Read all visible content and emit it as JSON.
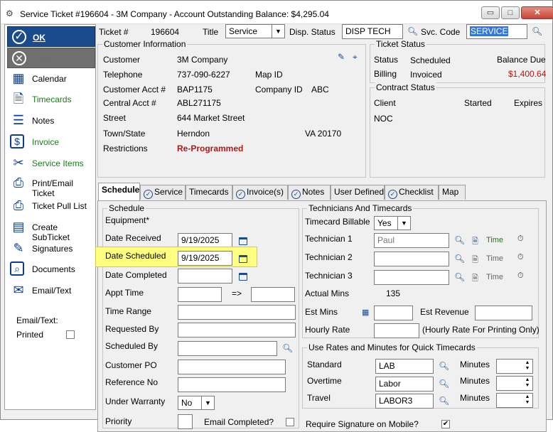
{
  "window": {
    "title": "Service Ticket #196604 - 3M Company - Account Outstanding Balance: $4,295.04",
    "minimize": "▭",
    "maximize": "□",
    "close": "✕"
  },
  "sidebar": {
    "ok": "OK",
    "cancel": "Cancel",
    "items": [
      {
        "label": "Calendar",
        "icon": "calendar-icon",
        "glyph": "▦"
      },
      {
        "label": "Timecards",
        "icon": "timecard-icon",
        "glyph": "🗎"
      },
      {
        "label": "Notes",
        "icon": "notes-icon",
        "glyph": "☰"
      },
      {
        "label": "Invoice",
        "icon": "invoice-icon",
        "glyph": "$"
      },
      {
        "label": "Service Items",
        "icon": "tools-icon",
        "glyph": "✂"
      },
      {
        "label": "Print/Email Ticket",
        "icon": "printer-icon",
        "glyph": "⎙"
      },
      {
        "label": "Ticket Pull List",
        "icon": "printer-icon",
        "glyph": "⎙"
      },
      {
        "label": "Create SubTicket",
        "icon": "subticket-icon",
        "glyph": "▤"
      },
      {
        "label": "Signatures",
        "icon": "signature-icon",
        "glyph": "✎"
      },
      {
        "label": "Documents",
        "icon": "documents-icon",
        "glyph": "⌕"
      },
      {
        "label": "Email/Text",
        "icon": "email-icon",
        "glyph": "✉"
      }
    ],
    "email_text_label": "Email/Text:",
    "printed_label": "Printed"
  },
  "header": {
    "ticket_label": "Ticket #",
    "ticket_value": "196604",
    "title_label": "Title",
    "title_value": "Service",
    "disp_status_label": "Disp. Status",
    "disp_status_value": "DISP TECH",
    "svc_code_label": "Svc. Code",
    "svc_code_value": "SERVICE"
  },
  "customer_info": {
    "legend": "Customer Information",
    "customer_label": "Customer",
    "customer_value": "3M Company",
    "telephone_label": "Telephone",
    "telephone_value": "737-090-6227",
    "map_id_label": "Map ID",
    "cust_acct_label": "Customer Acct #",
    "cust_acct_value": "BAP1175",
    "company_id_label": "Company ID",
    "company_id_value": "ABC",
    "central_acct_label": "Central Acct #",
    "central_acct_value": "ABL271175",
    "street_label": "Street",
    "street_value": "644 Market Street",
    "town_label": "Town/State",
    "town_value": "Herndon",
    "state_zip": "VA  20170",
    "restrictions_label": "Restrictions",
    "restrictions_value": "Re-Programmed"
  },
  "ticket_status": {
    "legend": "Ticket Status",
    "status_label": "Status",
    "status_value": "Scheduled",
    "balance_due_label": "Balance Due",
    "billing_label": "Billing",
    "billing_value": "Invoiced",
    "balance_due_value": "$1,400.64"
  },
  "contract_status": {
    "legend": "Contract Status",
    "client_label": "Client",
    "started_label": "Started",
    "expires_label": "Expires",
    "noc": "NOC"
  },
  "tabs": [
    {
      "label": "Schedule",
      "active": true,
      "icon": false
    },
    {
      "label": "Service",
      "icon": true
    },
    {
      "label": "Timecards",
      "icon": false
    },
    {
      "label": "Invoice(s)",
      "icon": true
    },
    {
      "label": "Notes",
      "icon": true
    },
    {
      "label": "User Defined",
      "icon": false
    },
    {
      "label": "Checklist",
      "icon": true
    },
    {
      "label": "Map",
      "icon": false
    }
  ],
  "schedule": {
    "legend": "Schedule",
    "equipment_label": "Equipment*",
    "date_received_label": "Date Received",
    "date_received_value": "9/19/2025",
    "date_scheduled_label": "Date Scheduled",
    "date_scheduled_value": "9/19/2025",
    "date_completed_label": "Date Completed",
    "appt_time_label": "Appt Time",
    "arrow": "=>",
    "time_range_label": "Time Range",
    "requested_by_label": "Requested By",
    "scheduled_by_label": "Scheduled By",
    "customer_po_label": "Customer PO",
    "reference_no_label": "Reference No",
    "under_warranty_label": "Under Warranty",
    "under_warranty_value": "No",
    "priority_label": "Priority",
    "email_completed_label": "Email Completed?"
  },
  "technicians": {
    "legend": "Technicians And Timecards",
    "billable_label": "Timecard Billable",
    "billable_value": "Yes",
    "tech1_label": "Technician 1",
    "tech1_value": "Paul",
    "tech2_label": "Technician 2",
    "tech3_label": "Technician 3",
    "time_label": "Time",
    "actual_mins_label": "Actual Mins",
    "actual_mins_value": "135",
    "est_mins_label": "Est Mins",
    "est_revenue_label": "Est Revenue",
    "hourly_rate_label": "Hourly Rate",
    "hourly_note": "(Hourly Rate For Printing Only)"
  },
  "quick_rates": {
    "legend": "Use Rates and Minutes for Quick Timecards",
    "standard_label": "Standard",
    "standard_value": "LAB",
    "overtime_label": "Overtime",
    "overtime_value": "Labor",
    "travel_label": "Travel",
    "travel_value": "LABOR3",
    "minutes_label": "Minutes"
  },
  "require_signature_label": "Require Signature on Mobile?",
  "require_signature_checked": "✔"
}
